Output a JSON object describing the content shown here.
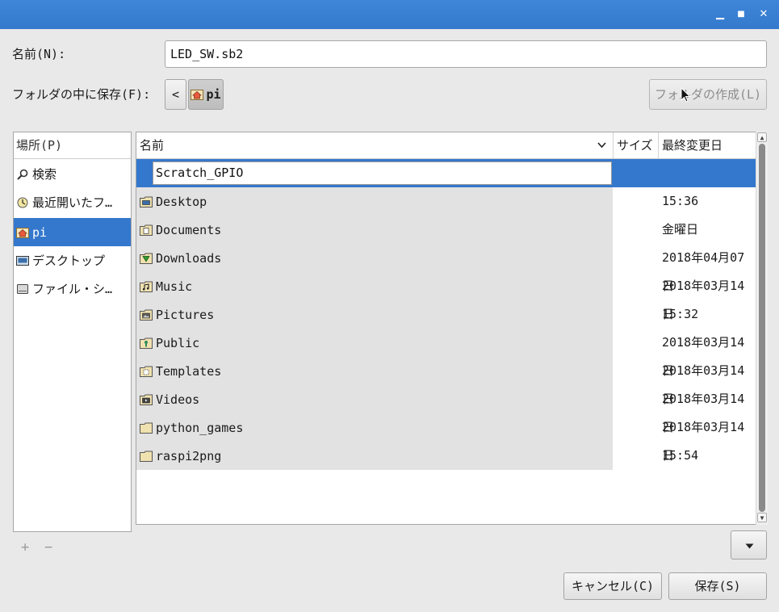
{
  "titlebar": {
    "minimize": "▁",
    "maximize": "■",
    "close": "✕"
  },
  "name_row": {
    "label": "名前(N):",
    "value": "LED_SW.sb2"
  },
  "folder_row": {
    "label": "フォルダの中に保存(F):",
    "back": "<",
    "current": "pi",
    "create_folder": "フォルダの作成(L)"
  },
  "places": {
    "header": "場所(P)",
    "items": [
      {
        "label": "検索",
        "icon": "search-icon"
      },
      {
        "label": "最近開いたフ…",
        "icon": "recent-icon"
      },
      {
        "label": "pi",
        "icon": "home-folder-icon",
        "selected": true
      },
      {
        "label": "デスクトップ",
        "icon": "desktop-icon"
      },
      {
        "label": "ファイル・シ…",
        "icon": "drive-icon"
      }
    ]
  },
  "filelist": {
    "columns": {
      "name": "名前",
      "size": "サイズ",
      "modified": "最終変更日"
    },
    "editing": "Scratch_GPIO",
    "rows": [
      {
        "name": "Desktop",
        "modified": "15:36",
        "icon": "desktop-folder-icon"
      },
      {
        "name": "Documents",
        "modified": "金曜日",
        "icon": "documents-folder-icon"
      },
      {
        "name": "Downloads",
        "modified": "2018年04月07日",
        "icon": "downloads-folder-icon"
      },
      {
        "name": "Music",
        "modified": "2018年03月14日",
        "icon": "music-folder-icon"
      },
      {
        "name": "Pictures",
        "modified": "15:32",
        "icon": "pictures-folder-icon"
      },
      {
        "name": "Public",
        "modified": "2018年03月14日",
        "icon": "public-folder-icon"
      },
      {
        "name": "Templates",
        "modified": "2018年03月14日",
        "icon": "templates-folder-icon"
      },
      {
        "name": "Videos",
        "modified": "2018年03月14日",
        "icon": "videos-folder-icon"
      },
      {
        "name": "python_games",
        "modified": "2018年03月14日",
        "icon": "folder-icon"
      },
      {
        "name": "raspi2png",
        "modified": "15:54",
        "icon": "folder-icon"
      }
    ]
  },
  "footer": {
    "add": "+",
    "remove": "−",
    "cancel": "キャンセル(C)",
    "save": "保存(S)"
  },
  "colors": {
    "titlebar": "#3379cc",
    "selection": "#3478cd"
  }
}
